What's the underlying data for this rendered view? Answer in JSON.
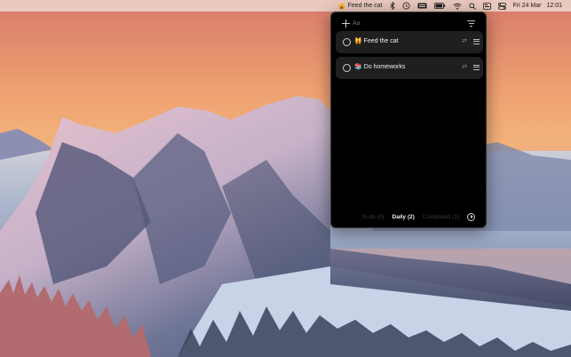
{
  "menubar": {
    "status_emoji": "🙀",
    "status_text": "Feed the cat",
    "date": "Fri 24 Mar",
    "time": "12:01",
    "icons": [
      "bluetooth-icon",
      "time-machine-icon",
      "keyboard-icon",
      "battery-icon",
      "wifi-icon",
      "search-icon",
      "screen-icon",
      "control-center-icon"
    ]
  },
  "popover": {
    "new_task_placeholder": "Aa",
    "tasks": [
      {
        "emoji": "🙀",
        "text": "Feed the cat",
        "done": false
      },
      {
        "emoji": "📚",
        "text": "Do homeworks",
        "done": false
      }
    ],
    "tabs": [
      {
        "label": "To-do (0)",
        "active": false
      },
      {
        "label": "Daily (2)",
        "active": true
      },
      {
        "label": "Completed (1)",
        "active": false
      }
    ]
  },
  "colors": {
    "popover_bg": "#000000",
    "task_bg": "#1f1f1f",
    "menubar_bg": "#ecd6cd"
  }
}
